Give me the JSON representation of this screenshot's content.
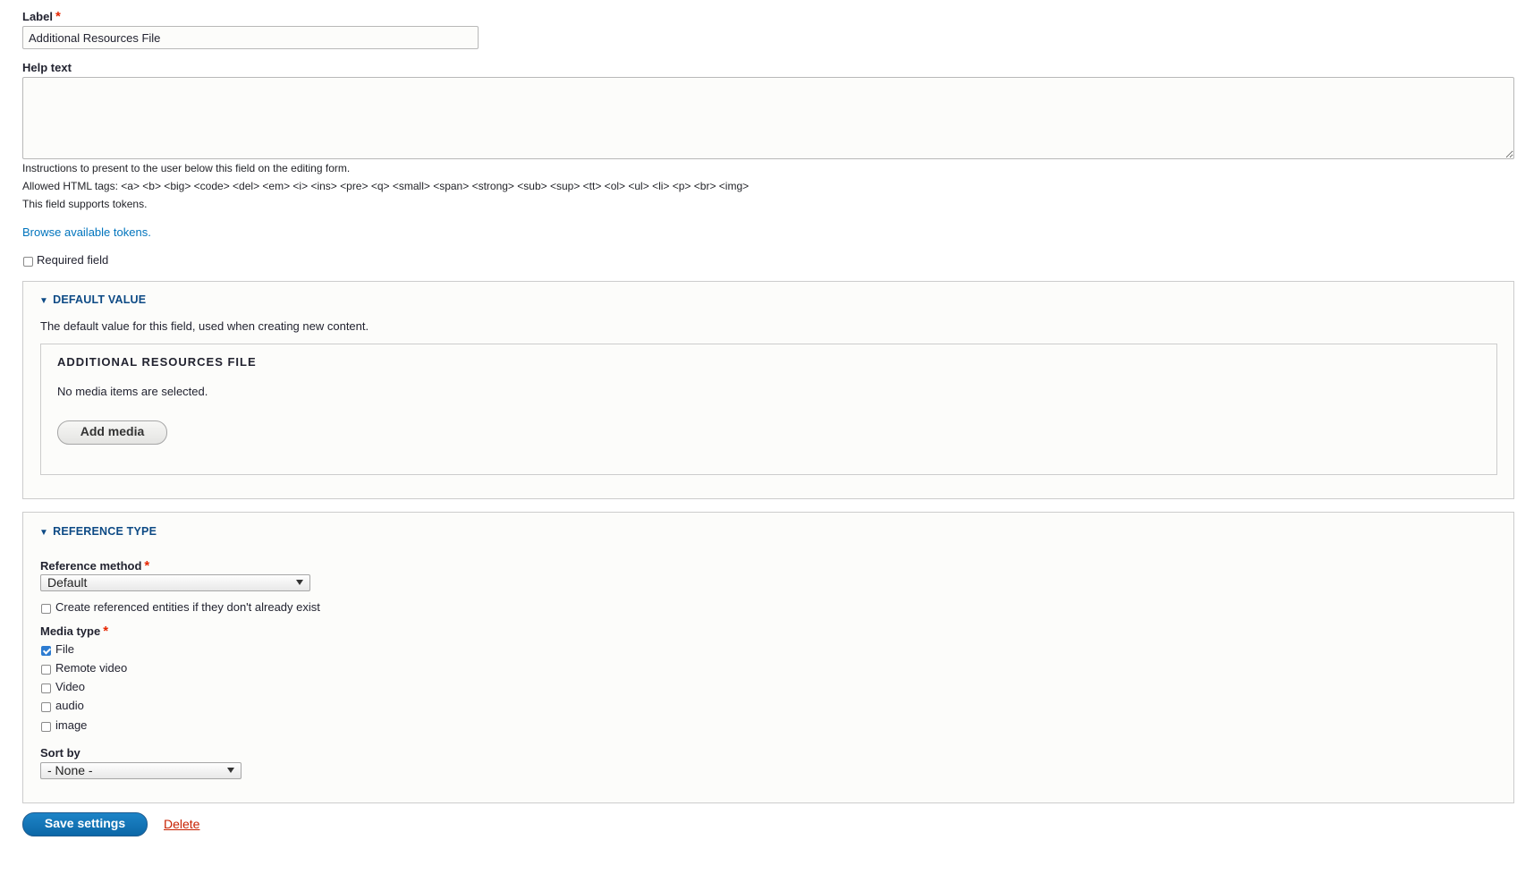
{
  "label_field": {
    "label": "Label",
    "required_mark": "*",
    "value": "Additional Resources File"
  },
  "help_text": {
    "label": "Help text",
    "value": "",
    "description": [
      "Instructions to present to the user below this field on the editing form.",
      "Allowed HTML tags: <a> <b> <big> <code> <del> <em> <i> <ins> <pre> <q> <small> <span> <strong> <sub> <sup> <tt> <ol> <ul> <li> <p> <br> <img>",
      "This field supports tokens."
    ],
    "browse_tokens_link": "Browse available tokens."
  },
  "required_field": {
    "label": "Required field",
    "checked": false
  },
  "default_value": {
    "summary": "Default value",
    "description": "The default value for this field, used when creating new content.",
    "widget_title": "ADDITIONAL RESOURCES FILE",
    "empty_text": "No media items are selected.",
    "add_media_button": "Add media"
  },
  "reference_type": {
    "summary": "Reference type",
    "reference_method": {
      "label": "Reference method",
      "required_mark": "*",
      "selected": "Default"
    },
    "auto_create": {
      "label": "Create referenced entities if they don't already exist",
      "checked": false
    },
    "media_type": {
      "label": "Media type",
      "required_mark": "*",
      "options": [
        {
          "label": "File",
          "checked": true
        },
        {
          "label": "Remote video",
          "checked": false
        },
        {
          "label": "Video",
          "checked": false
        },
        {
          "label": "audio",
          "checked": false
        },
        {
          "label": "image",
          "checked": false
        }
      ]
    },
    "sort_by": {
      "label": "Sort by",
      "selected": "- None -"
    }
  },
  "actions": {
    "save_button": "Save settings",
    "delete_link": "Delete"
  },
  "colors": {
    "accent_blue": "#0074bd",
    "save_button": "#1479bf",
    "required_red": "#e62600",
    "delete_red": "#c72100"
  }
}
